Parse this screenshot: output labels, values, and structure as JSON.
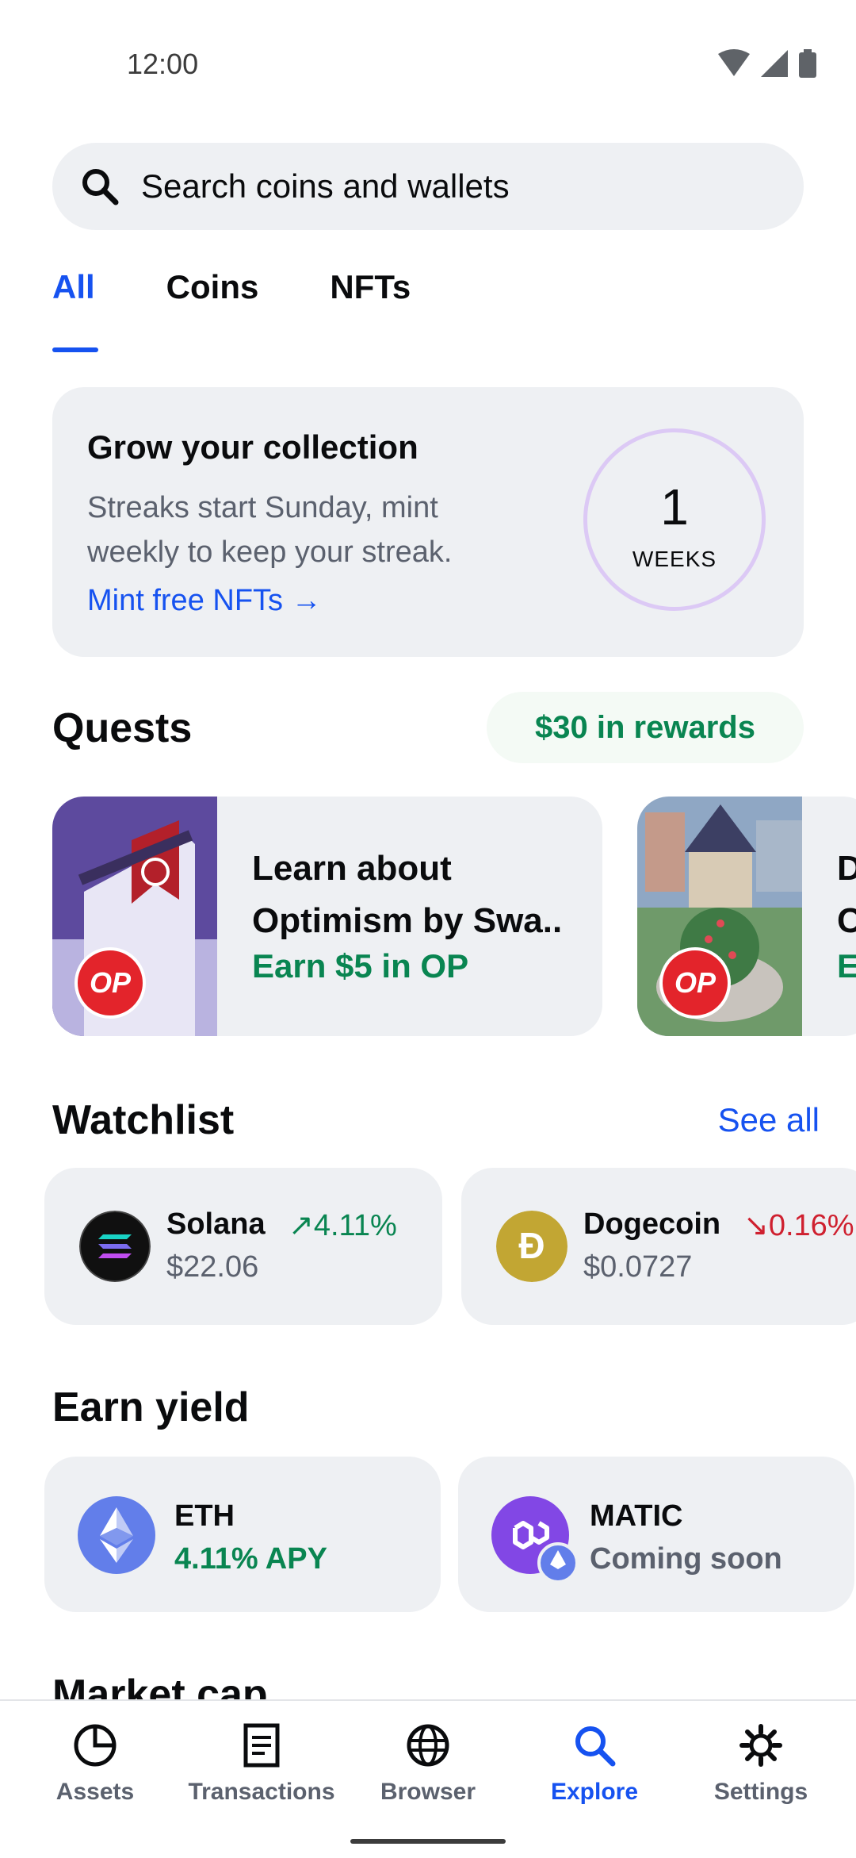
{
  "status_bar": {
    "time": "12:00"
  },
  "search": {
    "placeholder": "Search coins and wallets"
  },
  "tabs": [
    {
      "label": "All"
    },
    {
      "label": "Coins"
    },
    {
      "label": "NFTs"
    }
  ],
  "streak_card": {
    "title": "Grow your collection",
    "description": "Streaks start Sunday, mint weekly to keep your streak.",
    "link": "Mint free NFTs →",
    "count": "1",
    "unit": "WEEKS"
  },
  "quests": {
    "title": "Quests",
    "rewards": "$30 in rewards",
    "items": [
      {
        "title": "Learn about Optimism by Swa..",
        "earn": "Earn $5 in OP",
        "badge": "OP"
      },
      {
        "title": "D C",
        "earn": "E",
        "badge": "OP"
      }
    ]
  },
  "watchlist": {
    "title": "Watchlist",
    "see_all": "See all",
    "items": [
      {
        "name": "Solana",
        "price": "$22.06",
        "change": "↗4.11%",
        "direction": "up"
      },
      {
        "name": "Dogecoin",
        "price": "$0.0727",
        "change": "↘0.16%",
        "direction": "down"
      }
    ]
  },
  "earn_yield": {
    "title": "Earn yield",
    "items": [
      {
        "name": "ETH",
        "sub": "4.11% APY"
      },
      {
        "name": "MATIC",
        "sub": "Coming soon"
      }
    ]
  },
  "market_cap": {
    "title": "Market cap"
  },
  "nav": [
    {
      "label": "Assets",
      "icon": "pie-chart-icon"
    },
    {
      "label": "Transactions",
      "icon": "document-icon"
    },
    {
      "label": "Browser",
      "icon": "globe-icon"
    },
    {
      "label": "Explore",
      "icon": "search-icon",
      "active": true
    },
    {
      "label": "Settings",
      "icon": "gear-icon"
    }
  ],
  "colors": {
    "accent": "#1652f0",
    "positive": "#098551",
    "negative": "#cf202f",
    "card": "#eef0f3"
  }
}
